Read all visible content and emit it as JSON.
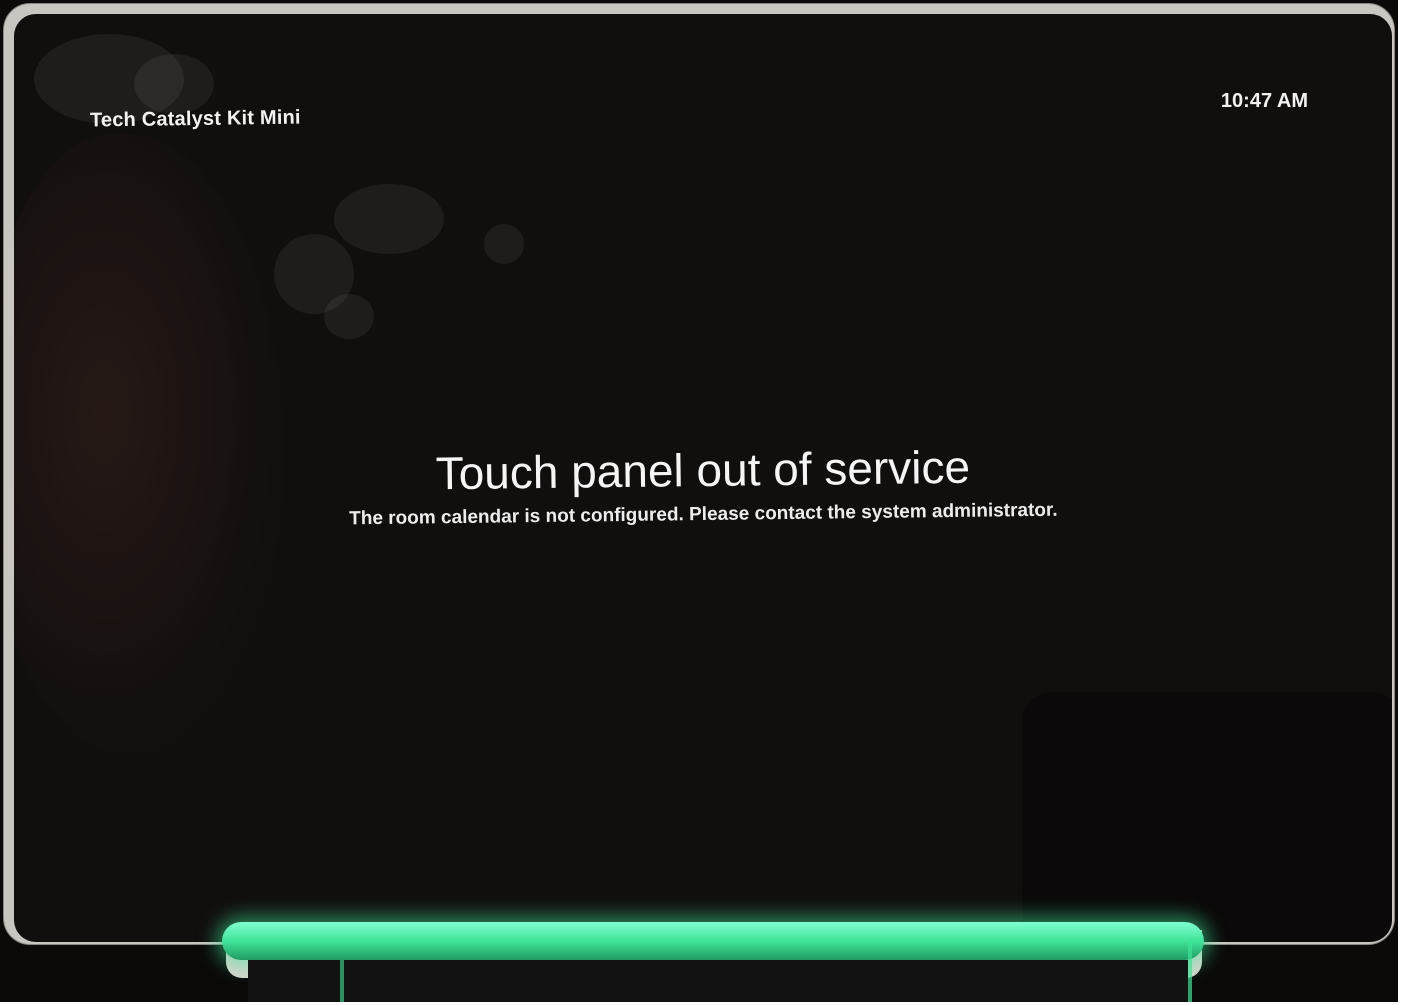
{
  "header": {
    "device_name": "Tech Catalyst Kit Mini",
    "time": "10:47 AM"
  },
  "status": {
    "title": "Touch panel out of service",
    "message": "The room calendar is not configured. Please contact the system administrator."
  },
  "colors": {
    "screen_background": "#110f0e",
    "text": "#f2f2f2",
    "led": "#41e39a"
  }
}
